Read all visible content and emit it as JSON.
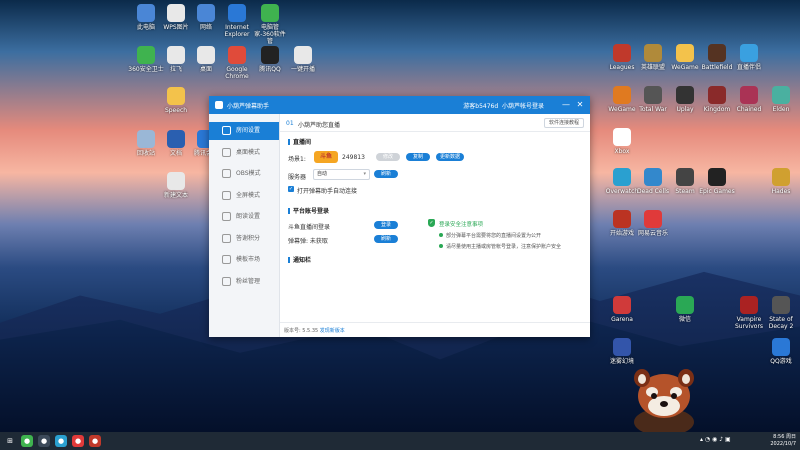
{
  "desktop": {
    "icons_left": [
      {
        "label": "此电脑",
        "icon": "computer-icon",
        "color": "#4a86d6"
      },
      {
        "label": "WPS图片",
        "icon": "wps-image-icon",
        "color": "#e8e8e8"
      },
      {
        "label": "网络",
        "icon": "network-icon",
        "color": "#4a86d6"
      },
      {
        "label": "Internet Explorer",
        "icon": "ie-icon",
        "color": "#2a78d6"
      },
      {
        "label": "电脑管家-360软件管",
        "icon": "pc-manager-icon",
        "color": "#3fb34f"
      },
      {
        "label": "360安全卫士",
        "icon": "shield-plus-icon",
        "color": "#3fb34f"
      },
      {
        "label": "拉飞",
        "icon": "file-icon",
        "color": "#e8e8e8"
      },
      {
        "label": "桌面",
        "icon": "file-icon",
        "color": "#e8e8e8"
      },
      {
        "label": "Google Chrome",
        "icon": "chrome-icon",
        "color": "#e04b3a"
      },
      {
        "label": "腾讯QQ",
        "icon": "qq-icon",
        "color": "#222222"
      },
      {
        "label": "一键开播",
        "icon": "file-icon",
        "color": "#e8e8e8"
      },
      {
        "label": "Speech",
        "icon": "folder-icon",
        "color": "#f3c24b"
      },
      {
        "label": "回收站",
        "icon": "recycle-bin-icon",
        "color": "#9ab7d6"
      },
      {
        "label": "文档",
        "icon": "word-icon",
        "color": "#2a5fb0"
      },
      {
        "label": "腾讯会议",
        "icon": "meeting-icon",
        "color": "#2a78d6"
      },
      {
        "label": "新建文本",
        "icon": "file-icon",
        "color": "#e8e8e8"
      }
    ],
    "icons_right": [
      {
        "label": "Leagues",
        "icon": "game-icon",
        "color": "#c0392b"
      },
      {
        "label": "英雄联盟",
        "icon": "game-icon",
        "color": "#b08a3a"
      },
      {
        "label": "WeGame",
        "icon": "game-icon",
        "color": "#f3c24b"
      },
      {
        "label": "Battlefield",
        "icon": "game-icon",
        "color": "#553322"
      },
      {
        "label": "直播伴侣",
        "icon": "game-icon",
        "color": "#3aa0e0"
      },
      {
        "label": "WeGame",
        "icon": "game-icon",
        "color": "#e07a20"
      },
      {
        "label": "Total War",
        "icon": "game-icon",
        "color": "#555555"
      },
      {
        "label": "Uplay",
        "icon": "game-icon",
        "color": "#333333"
      },
      {
        "label": "Kingdom",
        "icon": "game-icon",
        "color": "#8a2a2a"
      },
      {
        "label": "Chained",
        "icon": "game-icon",
        "color": "#aa3355"
      },
      {
        "label": "Elden",
        "icon": "game-icon",
        "color": "#4ab0a0"
      },
      {
        "label": "Xbox",
        "icon": "game-icon",
        "color": "#ffffff"
      },
      {
        "label": "Steam",
        "icon": "game-icon",
        "color": "#444444"
      },
      {
        "label": "Epic Games",
        "icon": "game-icon",
        "color": "#222222"
      },
      {
        "label": "Overwatch",
        "icon": "game-icon",
        "color": "#2aa0d0"
      },
      {
        "label": "Dead Cells",
        "icon": "game-icon",
        "color": "#3388cc"
      },
      {
        "label": "Hades",
        "icon": "game-icon",
        "color": "#d0a030"
      },
      {
        "label": "开始游戏",
        "icon": "game-icon",
        "color": "#bb3322"
      },
      {
        "label": "网易云音乐",
        "icon": "music-icon",
        "color": "#e03a3a"
      },
      {
        "label": "Garena",
        "icon": "game-icon",
        "color": "#d03a3a"
      },
      {
        "label": "微信",
        "icon": "wechat-icon",
        "color": "#2aa855"
      },
      {
        "label": "Vampire Survivors",
        "icon": "game-icon",
        "color": "#aa2222"
      },
      {
        "label": "State of Decay 2",
        "icon": "game-icon",
        "color": "#555555"
      },
      {
        "label": "迷雾幻境",
        "icon": "game-icon",
        "color": "#3355aa"
      },
      {
        "label": "QQ游戏",
        "icon": "game-icon",
        "color": "#2a78d6"
      }
    ]
  },
  "window": {
    "title": "小葫芦弹幕助手",
    "account": "游客b5476d",
    "switch_account": "小葫芦帐号登录",
    "controls": {
      "minimize": "—",
      "close": "✕"
    }
  },
  "sidebar": {
    "items": [
      {
        "label": "房间设置",
        "icon": "room-icon"
      },
      {
        "label": "桌面模式",
        "icon": "desktop-icon"
      },
      {
        "label": "OBS模式",
        "icon": "obs-icon"
      },
      {
        "label": "全屏模式",
        "icon": "fullscreen-icon"
      },
      {
        "label": "朗读设置",
        "icon": "speech-icon"
      },
      {
        "label": "答谢积分",
        "icon": "points-icon"
      },
      {
        "label": "模板市场",
        "icon": "template-icon"
      },
      {
        "label": "粉丝管理",
        "icon": "fans-icon"
      }
    ],
    "active_index": 0
  },
  "main": {
    "crumb_num": "01",
    "crumb": "小葫芦助您直播",
    "help_label": "软件连接教程",
    "section_room": "直播间",
    "room_label": "场景1:",
    "platform_logo": "斗鱼",
    "room_id": "249813",
    "btn_modify": "修改",
    "btn_copy": "复制",
    "btn_update": "更新数据",
    "server_label": "服务器",
    "server_value": "自动",
    "btn_refresh": "刷新",
    "auto_connect_label": "打开弹幕助手自动连接",
    "section_platform": "平台账号登录",
    "login_1": "斗鱼直播间登录",
    "login_1_btn": "登录",
    "login_2": "弹幕弹: 未获取",
    "login_2_btn": "刷新",
    "safe_title": "登录安全注意事项",
    "tips": [
      "部分弹幕平台需要将您的直播间设置为公开",
      "请尽量使用主播或房管帐号登录，注意保护账户安全"
    ],
    "section_notice": "通知栏",
    "version_label": "版本号: 5.5.35",
    "new_version": "发现新版本"
  },
  "taskbar": {
    "apps": [
      {
        "name": "start-icon",
        "color": "#1f2a36"
      },
      {
        "name": "xbox-icon",
        "color": "#3fb34f"
      },
      {
        "name": "file-explorer-icon",
        "color": "#3c4a5a"
      },
      {
        "name": "live-icon",
        "color": "#2aa0d0"
      },
      {
        "name": "netease-music-icon",
        "color": "#e03a3a"
      },
      {
        "name": "game-icon",
        "color": "#c0392b"
      }
    ],
    "time": "8:56 周日",
    "date": "2022/10/7"
  },
  "colors": {
    "accent": "#1a7fd6",
    "green": "#2aa855"
  }
}
